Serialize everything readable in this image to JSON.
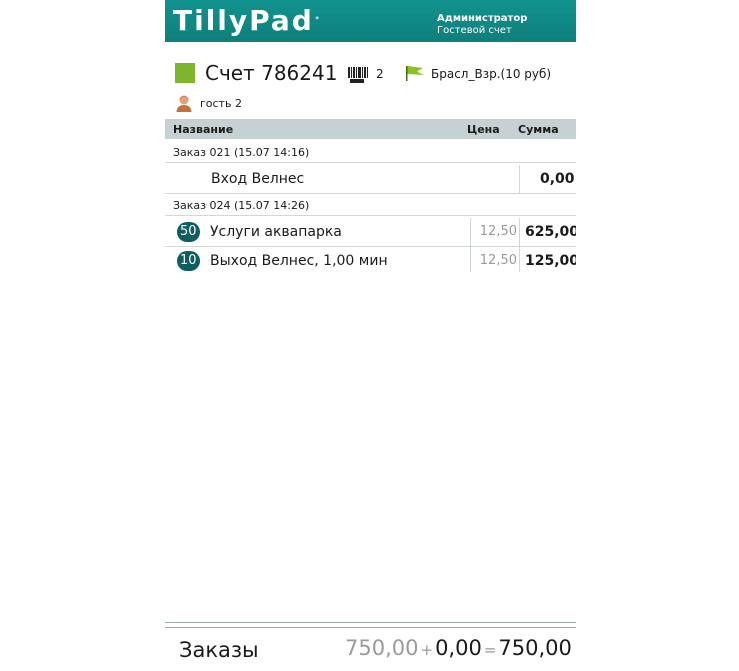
{
  "header": {
    "logo_text": "TillyPad",
    "user_role": "Администратор",
    "screen_name": "Гостевой счет",
    "bg_color": "#12938f"
  },
  "bill": {
    "title": "Счет 786241",
    "color": "#7fb52c",
    "barcode_count": "2",
    "bracelet": "Брасл_Взр.(10 руб)",
    "guest": "гость 2"
  },
  "table": {
    "columns": {
      "name": "Название",
      "price": "Цена",
      "sum": "Сумма"
    },
    "groups": [
      {
        "label": "Заказ 021 (15.07 14:16)",
        "items": [
          {
            "qty": "",
            "name": "Вход Велнес",
            "price": "",
            "sum": "0,00"
          }
        ]
      },
      {
        "label": "Заказ 024 (15.07 14:26)",
        "items": [
          {
            "qty": "50",
            "name": "Услуги аквапарка",
            "price": "12,50",
            "sum": "625,00"
          },
          {
            "qty": "10",
            "name": "Выход Велнес, 1,00 мин",
            "price": "12,50",
            "sum": "125,00"
          }
        ]
      }
    ]
  },
  "footer": {
    "label": "Заказы",
    "orders_amount": "750,00",
    "plus": "+",
    "discount": "0,00",
    "equals": "=",
    "total": "750,00"
  }
}
